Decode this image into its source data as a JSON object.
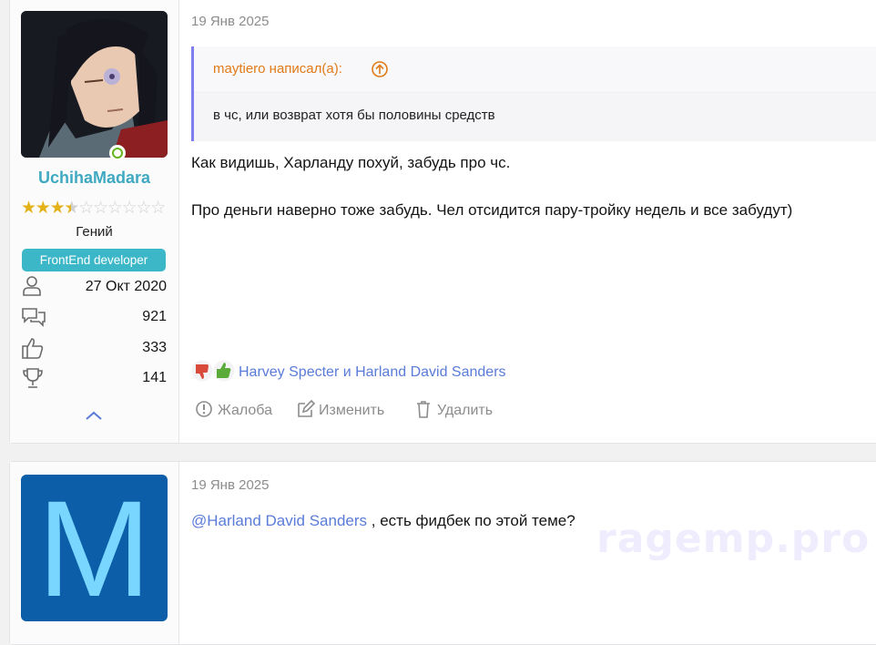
{
  "post1": {
    "user": {
      "username": "UchihaMadara",
      "rank": "Гений",
      "role_badge": "FrontEnd developer",
      "rating_stars": 3.5,
      "rating_max": 10,
      "stats": {
        "joined": "27 Окт 2020",
        "messages": "921",
        "reactions": "333",
        "points": "141"
      }
    },
    "date": "19 Янв 2025",
    "quote": {
      "author": "maytiero написал(а):",
      "text": "в чс, или возврат хотя бы половины средств"
    },
    "message_lines": [
      "Как видишь, Харланду похуй, забудь про чс.",
      "Про деньги наверно тоже забудь. Чел отсидится пару-тройку недель и все забудут)"
    ],
    "reactions": {
      "names": "Harvey Specter и Harland David Sanders"
    },
    "actions": {
      "report": "Жалоба",
      "edit": "Изменить",
      "delete": "Удалить"
    }
  },
  "post2": {
    "avatar_letter": "M",
    "date": "19 Янв 2025",
    "mention": "@Harland David Sanders",
    "message": " , есть фидбек по этой теме?"
  },
  "watermark": "ragemp.pro",
  "colors": {
    "username": "#3fa9c2",
    "badge": "#3cb7c7",
    "quote_author": "#e07a17",
    "link": "#5a7bd8",
    "quote_border": "#7e7ef0"
  }
}
